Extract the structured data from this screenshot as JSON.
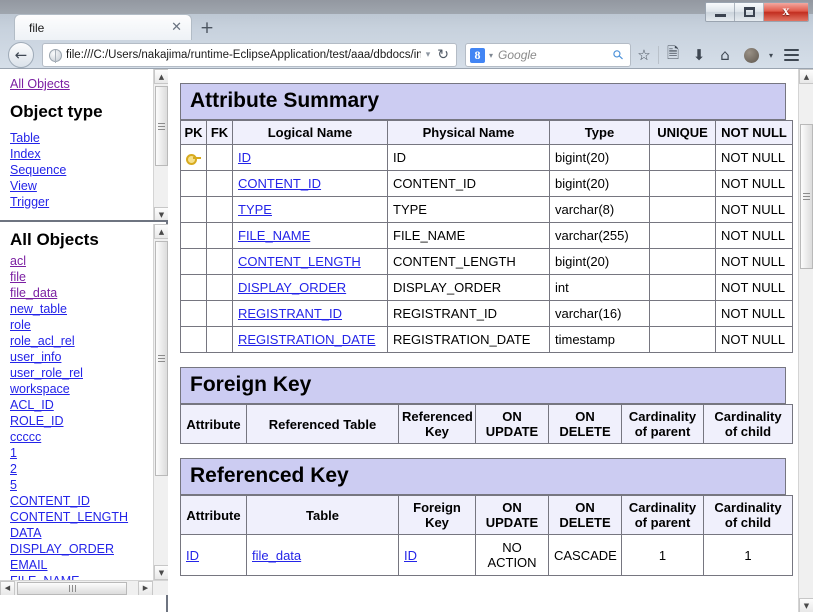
{
  "window": {
    "controls": {
      "minimize": "–",
      "maximize": "□",
      "close": "✕"
    }
  },
  "tabs": {
    "items": [
      {
        "label": "file",
        "close": "✕"
      }
    ],
    "new_tab": "+"
  },
  "toolbar": {
    "back": "←",
    "url": "file:///C:/Users/nakajima/runtime-EclipseApplication/test/aaa/dbdocs/index",
    "url_dropdown": "▾",
    "reload": "⟳",
    "search_engine": "8",
    "search_caret": "▾",
    "search_placeholder": "Google",
    "search_magnifier": "⚲",
    "bookmark": "☆",
    "reading_list": "▤",
    "download": "⬇",
    "home": "⌂",
    "avatar": "",
    "overflow_caret": "▾",
    "menu": "≡"
  },
  "sidebar": {
    "object_type_pane": {
      "all_objects_link": "All Objects",
      "heading": "Object type",
      "items": [
        "Table",
        "Index",
        "Sequence",
        "View",
        "Trigger"
      ]
    },
    "all_objects_pane": {
      "heading": "All Objects",
      "items": [
        "acl",
        "file",
        "file_data",
        "new_table",
        "role",
        "role_acl_rel",
        "user_info",
        "user_role_rel",
        "workspace",
        "ACL_ID",
        "ROLE_ID",
        "ccccc",
        "1",
        "2",
        "5",
        "CONTENT_ID",
        "CONTENT_LENGTH",
        "DATA",
        "DISPLAY_ORDER",
        "EMAIL",
        "FILE_NAME"
      ]
    },
    "scroll_up": "▲",
    "scroll_down": "▼",
    "scroll_left": "◄",
    "scroll_right": "►"
  },
  "main": {
    "attribute_summary": {
      "title": "Attribute Summary",
      "columns": [
        "PK",
        "FK",
        "Logical Name",
        "Physical Name",
        "Type",
        "UNIQUE",
        "NOT NULL"
      ],
      "rows": [
        {
          "pk": "key-icon",
          "fk": "",
          "logical": "ID",
          "physical": "ID",
          "type": "bigint(20)",
          "unique": "",
          "notnull": "NOT NULL"
        },
        {
          "pk": "",
          "fk": "",
          "logical": "CONTENT_ID",
          "physical": "CONTENT_ID",
          "type": "bigint(20)",
          "unique": "",
          "notnull": "NOT NULL"
        },
        {
          "pk": "",
          "fk": "",
          "logical": "TYPE",
          "physical": "TYPE",
          "type": "varchar(8)",
          "unique": "",
          "notnull": "NOT NULL"
        },
        {
          "pk": "",
          "fk": "",
          "logical": "FILE_NAME",
          "physical": "FILE_NAME",
          "type": "varchar(255)",
          "unique": "",
          "notnull": "NOT NULL"
        },
        {
          "pk": "",
          "fk": "",
          "logical": "CONTENT_LENGTH",
          "physical": "CONTENT_LENGTH",
          "type": "bigint(20)",
          "unique": "",
          "notnull": "NOT NULL"
        },
        {
          "pk": "",
          "fk": "",
          "logical": "DISPLAY_ORDER",
          "physical": "DISPLAY_ORDER",
          "type": "int",
          "unique": "",
          "notnull": "NOT NULL"
        },
        {
          "pk": "",
          "fk": "",
          "logical": "REGISTRANT_ID",
          "physical": "REGISTRANT_ID",
          "type": "varchar(16)",
          "unique": "",
          "notnull": "NOT NULL"
        },
        {
          "pk": "",
          "fk": "",
          "logical": "REGISTRATION_DATE",
          "physical": "REGISTRATION_DATE",
          "type": "timestamp",
          "unique": "",
          "notnull": "NOT NULL"
        }
      ]
    },
    "foreign_key": {
      "title": "Foreign Key",
      "columns": [
        "Attribute",
        "Referenced Table",
        "Referenced Key",
        "ON UPDATE",
        "ON DELETE",
        "Cardinality of parent",
        "Cardinality of child"
      ],
      "rows": []
    },
    "referenced_key": {
      "title": "Referenced Key",
      "columns": [
        "Attribute",
        "Table",
        "Foreign Key",
        "ON UPDATE",
        "ON DELETE",
        "Cardinality of parent",
        "Cardinality of child"
      ],
      "rows": [
        {
          "attribute": "ID",
          "table": "file_data",
          "foreign_key": "ID",
          "on_update": "NO ACTION",
          "on_delete": "CASCADE",
          "card_parent": "1",
          "card_child": "1"
        }
      ]
    }
  },
  "colors": {
    "section_header": "#ccccf2",
    "table_header": "#f0f0fc",
    "link": "#2424e8",
    "visited_link": "#7b1fa2",
    "border": "#767680",
    "key_icon": "#d7aa1e"
  }
}
